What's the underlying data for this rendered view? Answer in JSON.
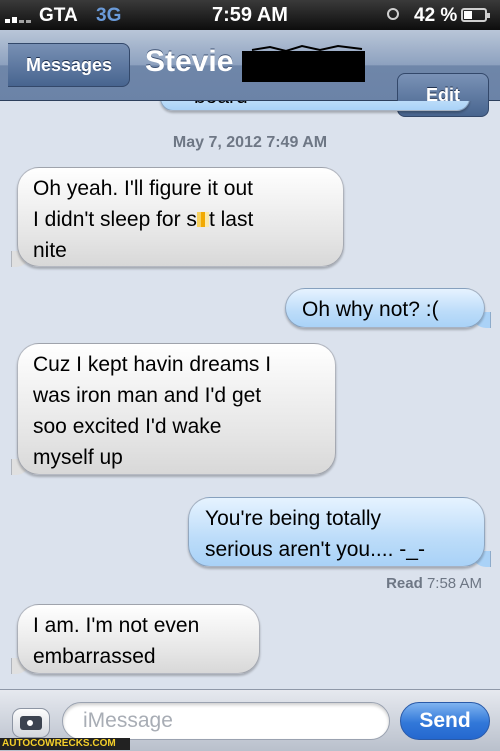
{
  "status_bar": {
    "carrier": "GTA",
    "network": "3G",
    "time": "7:59 AM",
    "battery": "42 %",
    "battery_level": 0.42
  },
  "nav": {
    "back_label": "Messages",
    "title": "Stevie",
    "edit_label": "Edit"
  },
  "conversation": {
    "partial_top": "board",
    "timestamp": "May 7, 2012 7:49 AM",
    "messages": [
      {
        "from": "them",
        "lines": [
          "Oh yeah. I'll figure it out",
          "I didn't sleep for s",
          "t last",
          "nite"
        ]
      },
      {
        "from": "me",
        "lines": [
          "Oh why not?  :("
        ]
      },
      {
        "from": "them",
        "lines": [
          "Cuz I kept havin dreams I",
          "was iron man and I'd get",
          "soo excited I'd wake",
          "myself up"
        ]
      },
      {
        "from": "me",
        "lines": [
          "You're being totally",
          "serious aren't you.... -_-"
        ]
      },
      {
        "from": "them",
        "lines": [
          "I am.  I'm not even",
          "embarrassed"
        ]
      }
    ],
    "read_label": "Read",
    "read_time": "7:58 AM"
  },
  "input_bar": {
    "placeholder": "iMessage",
    "send_label": "Send"
  },
  "watermark": "AUTOCOWRECKS.COM",
  "colors": {
    "incoming_bubble": "#e5e5e5",
    "outgoing_bubble": "#bcdcf9",
    "send_button": "#3278d9",
    "nav_bar": "#8da1bf"
  }
}
